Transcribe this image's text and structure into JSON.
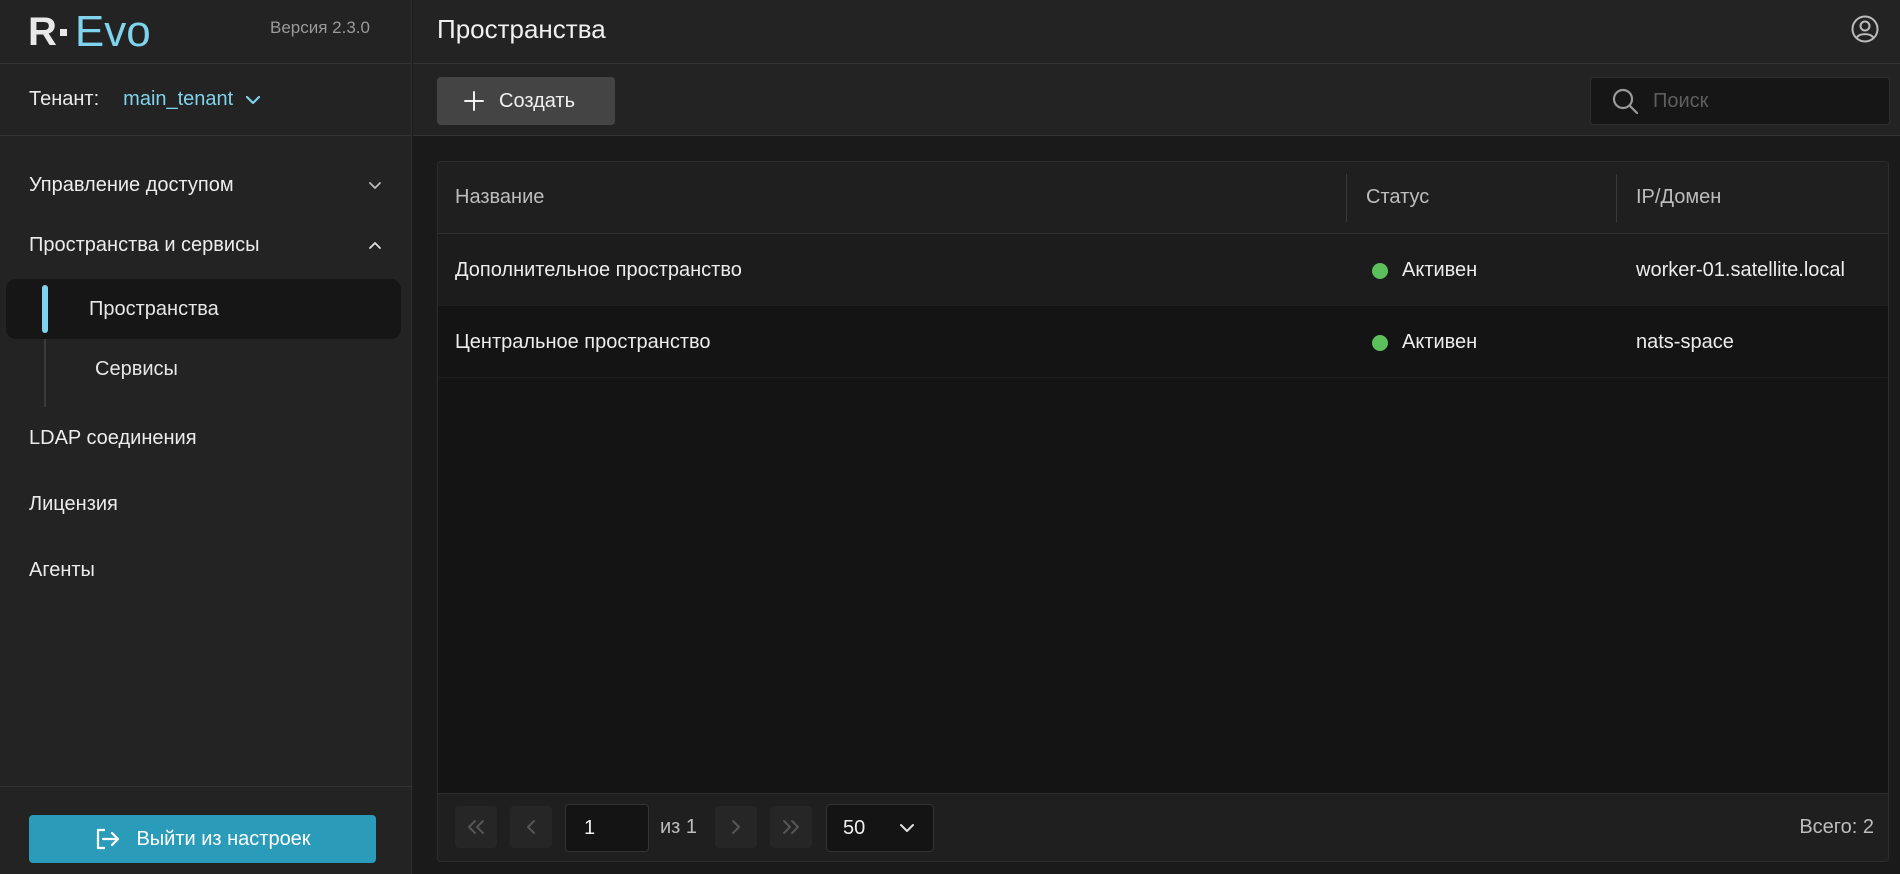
{
  "app": {
    "logo_r": "R",
    "logo_evo": "Evo",
    "version": "Версия 2.3.0"
  },
  "tenant": {
    "label": "Тенант:",
    "value": "main_tenant"
  },
  "sidebar": {
    "groups": [
      {
        "label": "Управление доступом",
        "expanded": false
      },
      {
        "label": "Пространства и сервисы",
        "expanded": true
      }
    ],
    "sub_items": [
      {
        "label": "Пространства",
        "active": true
      },
      {
        "label": "Сервисы",
        "active": false
      }
    ],
    "items": [
      {
        "label": "LDAP соединения"
      },
      {
        "label": "Лицензия"
      },
      {
        "label": "Агенты"
      }
    ],
    "exit_label": "Выйти из настроек"
  },
  "header": {
    "title": "Пространства"
  },
  "toolbar": {
    "create_label": "Создать",
    "search_placeholder": "Поиск",
    "search_value": ""
  },
  "table": {
    "columns": [
      "Название",
      "Статус",
      "IP/Домен"
    ],
    "rows": [
      {
        "name": "Дополнительное пространство",
        "status": "Активен",
        "host": "worker-01.satellite.local"
      },
      {
        "name": "Центральное пространство",
        "status": "Активен",
        "host": "nats-space"
      }
    ]
  },
  "pagination": {
    "page": "1",
    "of_text": "из 1",
    "per_page": "50",
    "total": "Всего: 2"
  },
  "colors": {
    "accent": "#7fd3ec",
    "exit_button": "#2b9bba",
    "status_active": "#5bc05b"
  }
}
